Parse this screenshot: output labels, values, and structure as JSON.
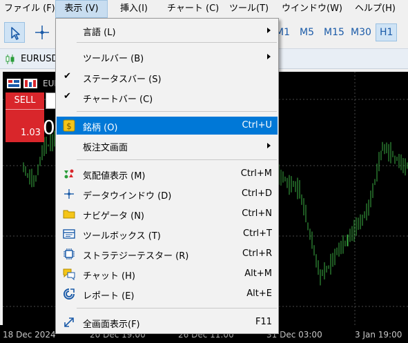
{
  "menubar": {
    "items": [
      {
        "label": "ファイル (F)"
      },
      {
        "label": "表示 (V)"
      },
      {
        "label": "挿入(I)"
      },
      {
        "label": "チャート (C)"
      },
      {
        "label": "ツール(T)"
      },
      {
        "label": "ウインドウ(W)"
      },
      {
        "label": "ヘルプ(H)"
      }
    ]
  },
  "toolbar": {
    "timeframes": [
      "M1",
      "M5",
      "M15",
      "M30",
      "H1"
    ],
    "selected_timeframe": "H1"
  },
  "tabbar": {
    "symbol": "EURUSD"
  },
  "chart": {
    "header_symbol": "EUR",
    "sell_label": "SELL",
    "price_small": "1.03",
    "price_big": "0",
    "x_labels": [
      "18 Dec 2024",
      "20 Dec 19:00",
      "26 Dec 11:00",
      "31 Dec 03:00",
      "3 Jan 19:00"
    ],
    "colors": {
      "background": "#000000",
      "candles": "#3cb043",
      "sell": "#d9262b"
    }
  },
  "view_menu": {
    "items": [
      {
        "label": "言語 (L)",
        "submenu": true
      },
      {
        "label": "ツールバー (B)",
        "submenu": true
      },
      {
        "label": "ステータスバー (S)",
        "checked": true
      },
      {
        "label": "チャートバー (C)",
        "checked": true
      },
      {
        "label": "銘柄 (O)",
        "shortcut": "Ctrl+U",
        "highlighted": true,
        "icon": "dollar-icon"
      },
      {
        "label": "板注文画面",
        "submenu": true
      },
      {
        "label": "気配値表示 (M)",
        "shortcut": "Ctrl+M",
        "icon": "market-watch-icon"
      },
      {
        "label": "データウインドウ (D)",
        "shortcut": "Ctrl+D",
        "icon": "crosshair-icon"
      },
      {
        "label": "ナビゲータ (N)",
        "shortcut": "Ctrl+N",
        "icon": "folder-icon"
      },
      {
        "label": "ツールボックス (T)",
        "shortcut": "Ctrl+T",
        "icon": "toolbox-icon"
      },
      {
        "label": "ストラテジーテスター (R)",
        "shortcut": "Ctrl+R",
        "icon": "chip-icon"
      },
      {
        "label": "チャット (H)",
        "shortcut": "Alt+M",
        "icon": "chat-icon"
      },
      {
        "label": "レポート (E)",
        "shortcut": "Alt+E",
        "icon": "report-icon"
      },
      {
        "label": "全画面表示(F)",
        "shortcut": "F11",
        "icon": "fullscreen-icon"
      }
    ],
    "highlight_color": "#0078d7"
  }
}
